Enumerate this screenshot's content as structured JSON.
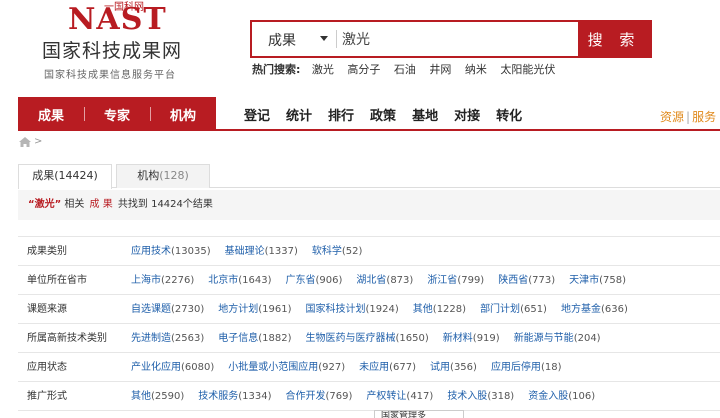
{
  "logo": {
    "nast": "NAST",
    "small": "一国科网",
    "cn": "国家科技成果网",
    "sub": "国家科技成果信息服务平台"
  },
  "search": {
    "category": "成果",
    "query": "激光",
    "button": "搜 索"
  },
  "hot": {
    "label": "热门搜索:",
    "items": [
      "激光",
      "高分子",
      "石油",
      "井网",
      "纳米",
      "太阳能光伏"
    ]
  },
  "nav": {
    "primary": [
      "成果",
      "专家",
      "机构"
    ],
    "secondary": [
      "登记",
      "统计",
      "排行",
      "政策",
      "基地",
      "对接",
      "转化"
    ],
    "right": [
      "资源",
      "服务"
    ]
  },
  "tabs": [
    {
      "label": "成果",
      "count": "(14424)"
    },
    {
      "label": "机构",
      "count": "(128)"
    }
  ],
  "summary": {
    "keyword": "“激光”",
    "related": "相关",
    "category": "成 果",
    "text": "共找到 14424个结果"
  },
  "filters": [
    {
      "label": "成果类别",
      "items": [
        {
          "name": "应用技术",
          "count": "(13035)"
        },
        {
          "name": "基础理论",
          "count": "(1337)"
        },
        {
          "name": "软科学",
          "count": "(52)"
        }
      ]
    },
    {
      "label": "单位所在省市",
      "items": [
        {
          "name": "上海市",
          "count": "(2276)"
        },
        {
          "name": "北京市",
          "count": "(1643)"
        },
        {
          "name": "广东省",
          "count": "(906)"
        },
        {
          "name": "湖北省",
          "count": "(873)"
        },
        {
          "name": "浙江省",
          "count": "(799)"
        },
        {
          "name": "陕西省",
          "count": "(773)"
        },
        {
          "name": "天津市",
          "count": "(758)"
        }
      ]
    },
    {
      "label": "课题来源",
      "items": [
        {
          "name": "自选课题",
          "count": "(2730)"
        },
        {
          "name": "地方计划",
          "count": "(1961)"
        },
        {
          "name": "国家科技计划",
          "count": "(1924)"
        },
        {
          "name": "其他",
          "count": "(1228)"
        },
        {
          "name": "部门计划",
          "count": "(651)"
        },
        {
          "name": "地方基金",
          "count": "(636)"
        }
      ]
    },
    {
      "label": "所属高新技术类别",
      "items": [
        {
          "name": "先进制造",
          "count": "(2563)"
        },
        {
          "name": "电子信息",
          "count": "(1882)"
        },
        {
          "name": "生物医药与医疗器械",
          "count": "(1650)"
        },
        {
          "name": "新材料",
          "count": "(919)"
        },
        {
          "name": "新能源与节能",
          "count": "(204)"
        }
      ]
    },
    {
      "label": "应用状态",
      "items": [
        {
          "name": "产业化应用",
          "count": "(6080)"
        },
        {
          "name": "小批量或小范围应用",
          "count": "(927)"
        },
        {
          "name": "未应用",
          "count": "(677)"
        },
        {
          "name": "试用",
          "count": "(356)"
        },
        {
          "name": "应用后停用",
          "count": "(18)"
        }
      ]
    },
    {
      "label": "推广形式",
      "items": [
        {
          "name": "其他",
          "count": "(2590)"
        },
        {
          "name": "技术服务",
          "count": "(1334)"
        },
        {
          "name": "合作开发",
          "count": "(769)"
        },
        {
          "name": "产权转让",
          "count": "(417)"
        },
        {
          "name": "技术入股",
          "count": "(318)"
        },
        {
          "name": "资金入股",
          "count": "(106)"
        }
      ]
    }
  ],
  "popup": "国家管理多",
  "colors": {
    "brand": "#b81c22",
    "link": "#1f5faa",
    "accent": "#e08a1c"
  }
}
